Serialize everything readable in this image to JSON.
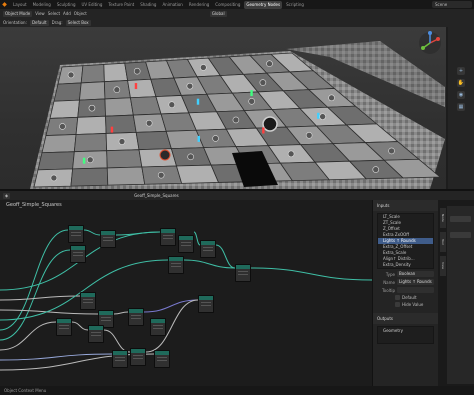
{
  "topbar": {
    "logo_glyph": "◆",
    "tabs": [
      "Layout",
      "Modeling",
      "Sculpting",
      "UV Editing",
      "Texture Paint",
      "Shading",
      "Animation",
      "Rendering",
      "Compositing",
      "Geometry Nodes",
      "Scripting"
    ],
    "active_tab": "Geometry Nodes",
    "scene": "Scene"
  },
  "viewport_header": {
    "mode": "Object Mode",
    "menus": [
      "View",
      "Select",
      "Add",
      "Object"
    ],
    "orientation_label": "Orientation:",
    "orientation_value": "Default",
    "drag_label": "Drag:",
    "drag_value": "Select Box",
    "transform": "Global"
  },
  "node_editor": {
    "tree_name": "Geoff_Simple_Squares",
    "breadcrumb": "Geoff_Simple_Squares"
  },
  "side_panel": {
    "inputs_header": "Inputs",
    "inputs": [
      "LT_Scale",
      "ZT_Scale",
      "Z_Offset",
      "Extra ZxOOff",
      "Lights ↑ Rounds",
      "Extra_Z_Offset",
      "Extra_Scale",
      "Align↑ Distrib...",
      "Extra_Density"
    ],
    "selected_input": "Lights ↑ Rounds",
    "type_label": "Type",
    "type_value": "Boolean",
    "name_label": "Name",
    "name_value": "Lights ↑ Rounds",
    "tooltip_label": "Tooltip",
    "default_label": "Default",
    "hide_value_label": "Hide Value",
    "outputs_header": "Outputs",
    "outputs": [
      "Geometry"
    ]
  },
  "status_bar": {
    "text": "Object Context Menu"
  },
  "colors": {
    "accent": "#e87d0d",
    "selection": "#3f5c8a",
    "node_header": "#1f6a5b",
    "link": "#3fbfa6"
  }
}
